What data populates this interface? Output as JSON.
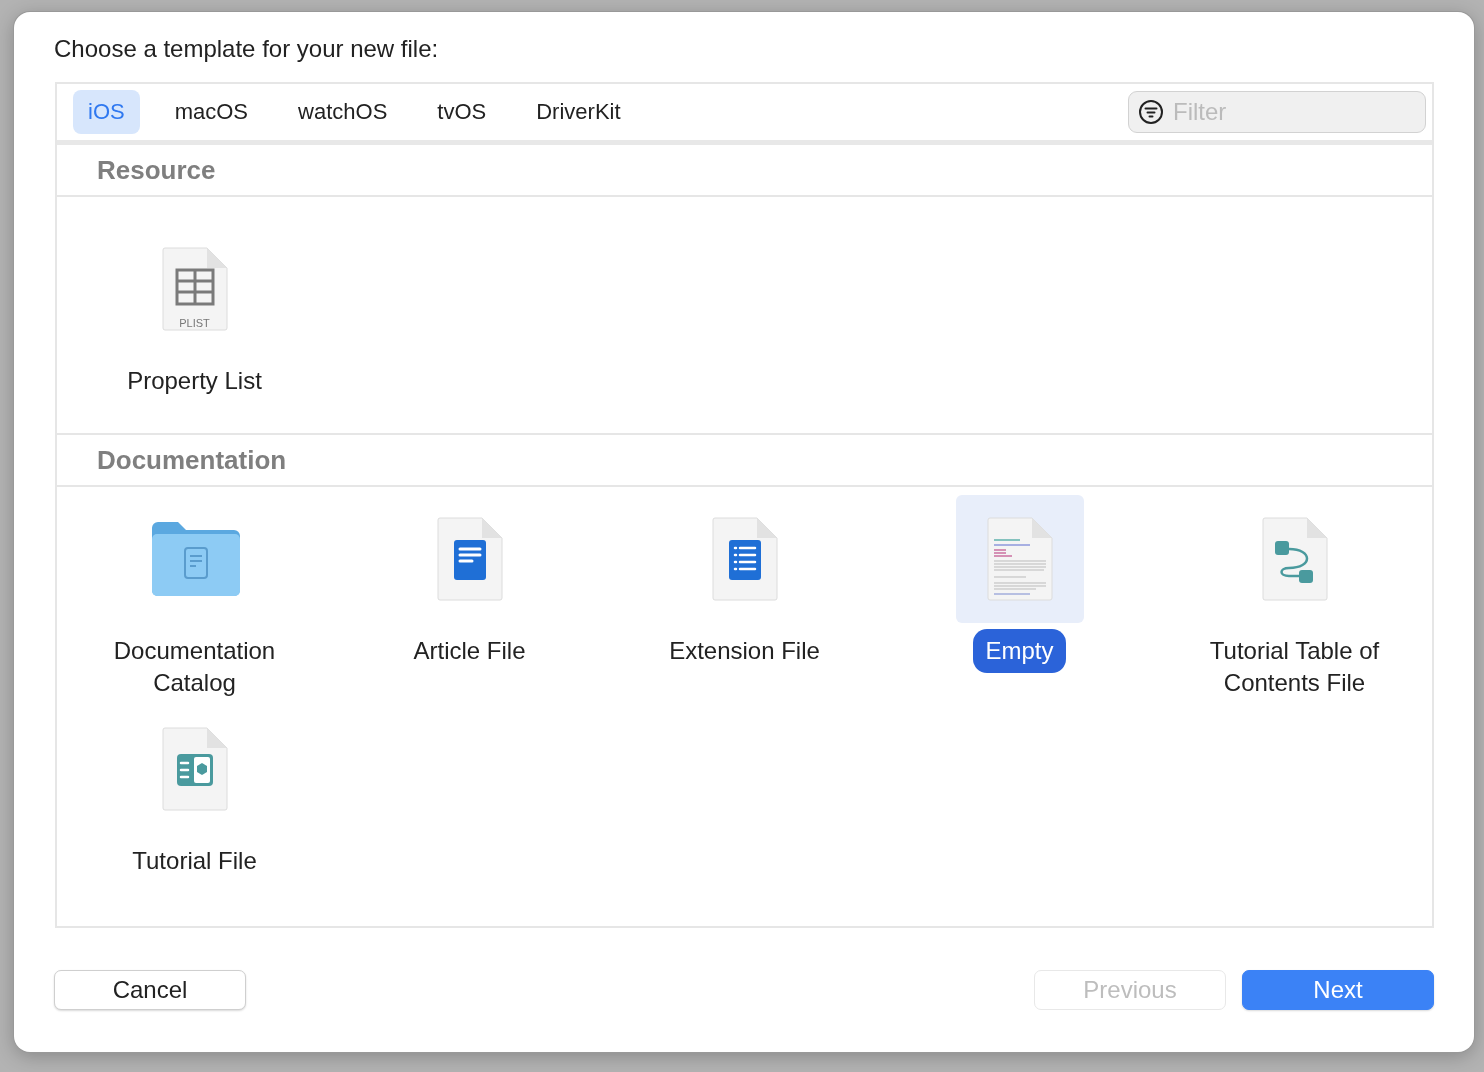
{
  "dialog": {
    "title": "Choose a template for your new file:"
  },
  "tabs": [
    {
      "label": "iOS",
      "selected": true
    },
    {
      "label": "macOS",
      "selected": false
    },
    {
      "label": "watchOS",
      "selected": false
    },
    {
      "label": "tvOS",
      "selected": false
    },
    {
      "label": "DriverKit",
      "selected": false
    }
  ],
  "filter": {
    "placeholder": "Filter"
  },
  "sections": [
    {
      "title": "Resource",
      "items": [
        {
          "label": "Property List",
          "kind": "plist",
          "icon_text": "PLIST",
          "selected": false
        }
      ]
    },
    {
      "title": "Documentation",
      "items": [
        {
          "label": "Documentation Catalog",
          "kind": "folder",
          "selected": false
        },
        {
          "label": "Article File",
          "kind": "article",
          "selected": false
        },
        {
          "label": "Extension File",
          "kind": "extension",
          "selected": false
        },
        {
          "label": "Empty",
          "kind": "markdown",
          "selected": true
        },
        {
          "label": "Tutorial Table of Contents File",
          "kind": "toc",
          "selected": false
        },
        {
          "label": "Tutorial File",
          "kind": "tutorial",
          "selected": false
        }
      ]
    }
  ],
  "buttons": [
    {
      "label": "Cancel",
      "disabled": false,
      "primary": false
    },
    {
      "label": "Previous",
      "disabled": true,
      "primary": false
    },
    {
      "label": "Next",
      "disabled": false,
      "primary": true
    }
  ]
}
